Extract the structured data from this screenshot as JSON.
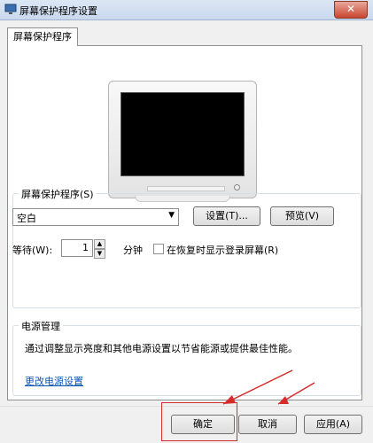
{
  "window": {
    "title": "屏幕保护程序设置",
    "close_glyph": "✕"
  },
  "tab": {
    "label": "屏幕保护程序"
  },
  "screensaver": {
    "group_label": "屏幕保护程序(S)",
    "selected": "空白",
    "settings_label": "设置(T)...",
    "preview_label": "预览(V)",
    "wait_label": "等待(W):",
    "wait_value": "1",
    "minutes_label": "分钟",
    "resume_label": "在恢复时显示登录屏幕(R)",
    "resume_checked": false
  },
  "power": {
    "group_label": "电源管理",
    "description": "通过调整显示亮度和其他电源设置以节省能源或提供最佳性能。",
    "link_label": "更改电源设置"
  },
  "buttons": {
    "ok": "确定",
    "cancel": "取消",
    "apply": "应用(A)"
  },
  "colors": {
    "annotation": "#d62b2b",
    "link": "#0b55b9"
  }
}
